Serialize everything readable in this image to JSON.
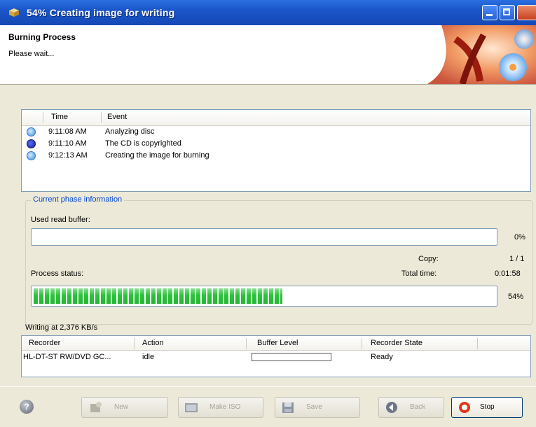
{
  "window": {
    "title": "54% Creating image for writing"
  },
  "header": {
    "title": "Burning Process",
    "subtitle": "Please wait..."
  },
  "log": {
    "columns": {
      "time": "Time",
      "event": "Event"
    },
    "rows": [
      {
        "icon": "info-icon",
        "time": "9:11:08 AM",
        "event": "Analyzing disc"
      },
      {
        "icon": "copyright-icon",
        "time": "9:11:10 AM",
        "event": "The CD is copyrighted"
      },
      {
        "icon": "info-icon",
        "time": "9:12:13 AM",
        "event": "Creating the image for burning"
      }
    ]
  },
  "phase": {
    "legend": "Current phase information",
    "buffer_label": "Used read buffer:",
    "buffer_percent": "0%",
    "buffer_value": 0,
    "copy_label": "Copy:",
    "copy_value": "1 / 1",
    "status_label": "Process status:",
    "total_time_label": "Total time:",
    "total_time_value": "0:01:58",
    "progress_percent": "54%",
    "progress_value": 0.54,
    "writing_speed": "Writing at 2,376 KB/s"
  },
  "recorders": {
    "columns": {
      "recorder": "Recorder",
      "action": "Action",
      "buffer_level": "Buffer Level",
      "state": "Recorder State"
    },
    "rows": [
      {
        "recorder": "HL-DT-ST RW/DVD GC...",
        "action": "idle",
        "buffer_level": 0,
        "state": "Ready"
      }
    ]
  },
  "buttons": {
    "new": "New",
    "make_iso": "Make ISO",
    "save": "Save",
    "back": "Back",
    "stop": "Stop"
  },
  "colors": {
    "title_bar": "#1a55c9",
    "progress_fill": "#2bc33b",
    "legend_text": "#0046d5",
    "stop_icon": "#e0371b"
  }
}
